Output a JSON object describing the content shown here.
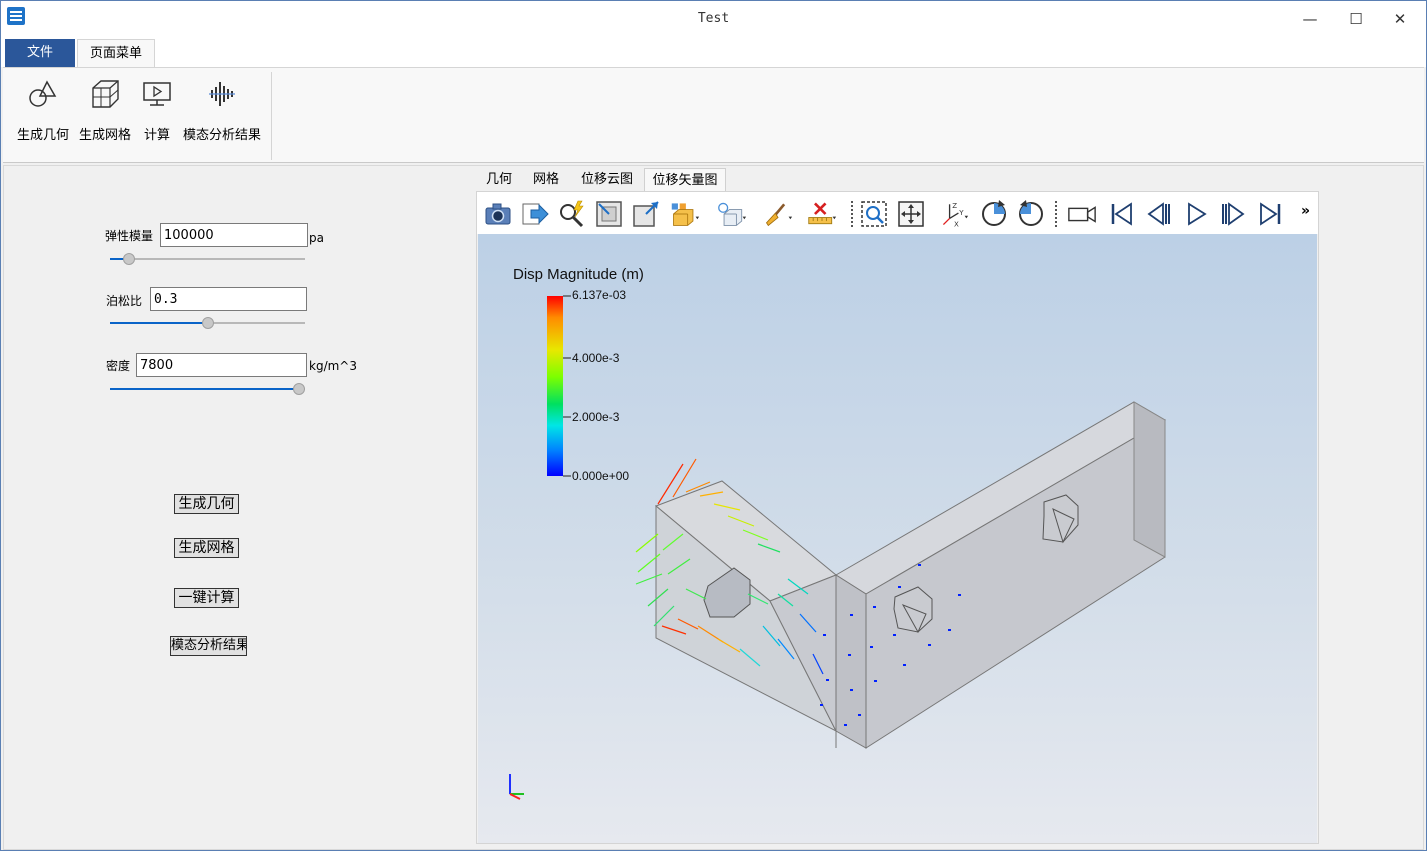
{
  "window": {
    "title": "Test",
    "controls": [
      "—",
      "☐",
      "✕"
    ]
  },
  "ribbon": {
    "tabs": [
      {
        "label": "文件",
        "active": false
      },
      {
        "label": "页面菜单",
        "active": true
      }
    ],
    "buttons": [
      {
        "label": "生成几何",
        "icon": "geometry-icon"
      },
      {
        "label": "生成网格",
        "icon": "mesh-icon"
      },
      {
        "label": "计算",
        "icon": "compute-icon"
      },
      {
        "label": "模态分析结果",
        "icon": "modal-result-icon"
      }
    ]
  },
  "params": {
    "elastic_modulus": {
      "label": "弹性模量",
      "value": "100000",
      "unit": "pa",
      "slider_fraction": 0.07
    },
    "poisson_ratio": {
      "label": "泊松比",
      "value": "0.3",
      "unit": "",
      "slider_fraction": 0.5
    },
    "density": {
      "label": "密度",
      "value": "7800",
      "unit": "kg/m^3",
      "slider_fraction": 1.0
    }
  },
  "actions": {
    "gen_geometry": "生成几何",
    "gen_mesh": "生成网格",
    "one_click_compute": "一键计算",
    "modal_result": "模态分析结果"
  },
  "viewer": {
    "tabs": [
      {
        "label": "几何",
        "active": false
      },
      {
        "label": "网格",
        "active": false
      },
      {
        "label": "位移云图",
        "active": false
      },
      {
        "label": "位移矢量图",
        "active": true
      }
    ],
    "toolbar_icons": [
      "camera-icon",
      "export-icon",
      "probe-icon",
      "zoom-box-icon",
      "fit-view-icon",
      "display-mode-icon",
      "light-icon",
      "clean-brush-icon",
      "ruler-clear-icon",
      "zoom-select-icon",
      "pan-icon",
      "axes-icon",
      "rotate-cw-icon",
      "rotate-ccw-icon",
      "video-camera-icon",
      "first-frame-icon",
      "prev-frame-icon",
      "play-icon",
      "next-frame-icon",
      "last-frame-icon"
    ],
    "overflow": "»",
    "legend": {
      "title": "Disp Magnitude (m)",
      "ticks": [
        "6.137e-03",
        "4.000e-3",
        "2.000e-3",
        "0.000e+00"
      ],
      "max": 0.006137,
      "min": 0.0
    }
  }
}
